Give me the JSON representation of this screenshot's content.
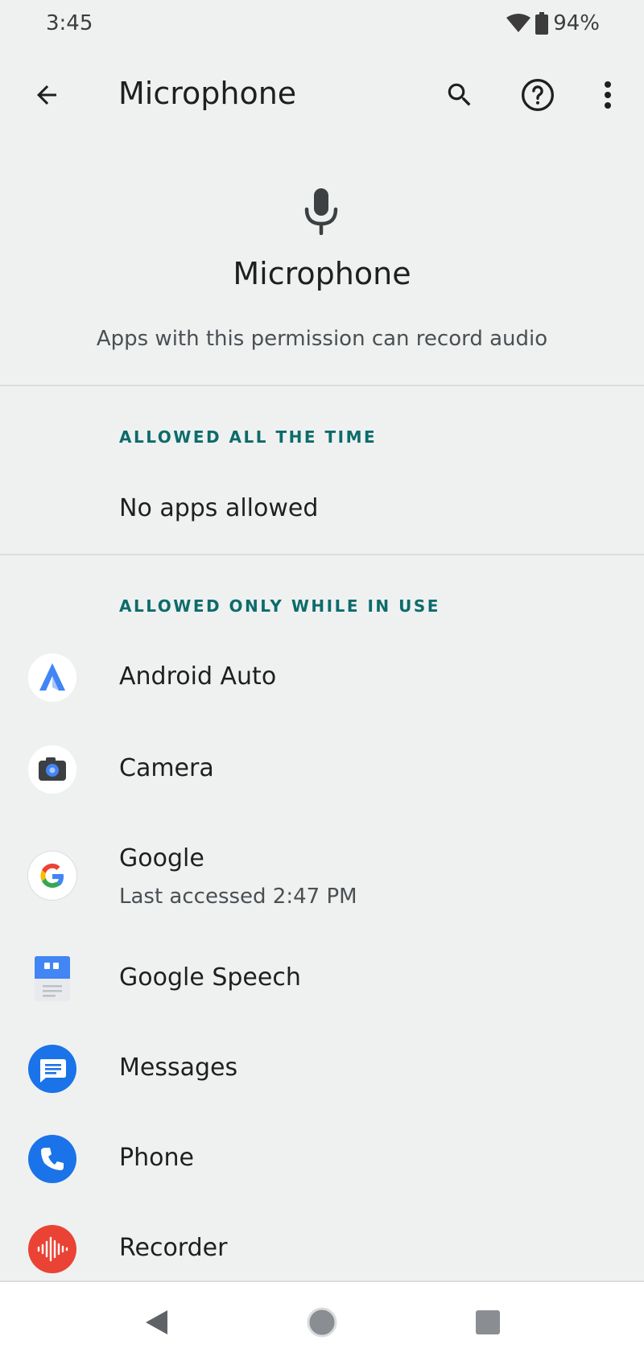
{
  "status": {
    "time": "3:45",
    "battery": "94%"
  },
  "toolbar": {
    "title": "Microphone"
  },
  "hero": {
    "title": "Microphone",
    "description": "Apps with this permission can record audio"
  },
  "sections": {
    "always": {
      "header": "ALLOWED ALL THE TIME",
      "empty": "No apps allowed"
    },
    "in_use": {
      "header": "ALLOWED ONLY WHILE IN USE"
    }
  },
  "apps": [
    {
      "name": "Android Auto",
      "icon": "android-auto-icon"
    },
    {
      "name": "Camera",
      "icon": "camera-icon"
    },
    {
      "name": "Google",
      "subtitle": "Last accessed 2:47 PM",
      "icon": "google-icon"
    },
    {
      "name": "Google Speech",
      "icon": "google-speech-icon"
    },
    {
      "name": "Messages",
      "icon": "messages-icon"
    },
    {
      "name": "Phone",
      "icon": "phone-icon"
    },
    {
      "name": "Recorder",
      "icon": "recorder-icon"
    }
  ],
  "colors": {
    "background": "#eff1f1",
    "section_header": "#0d6b6b",
    "divider": "#dadcde",
    "accent_blue": "#1a73e8",
    "recorder_red": "#ea4335"
  }
}
